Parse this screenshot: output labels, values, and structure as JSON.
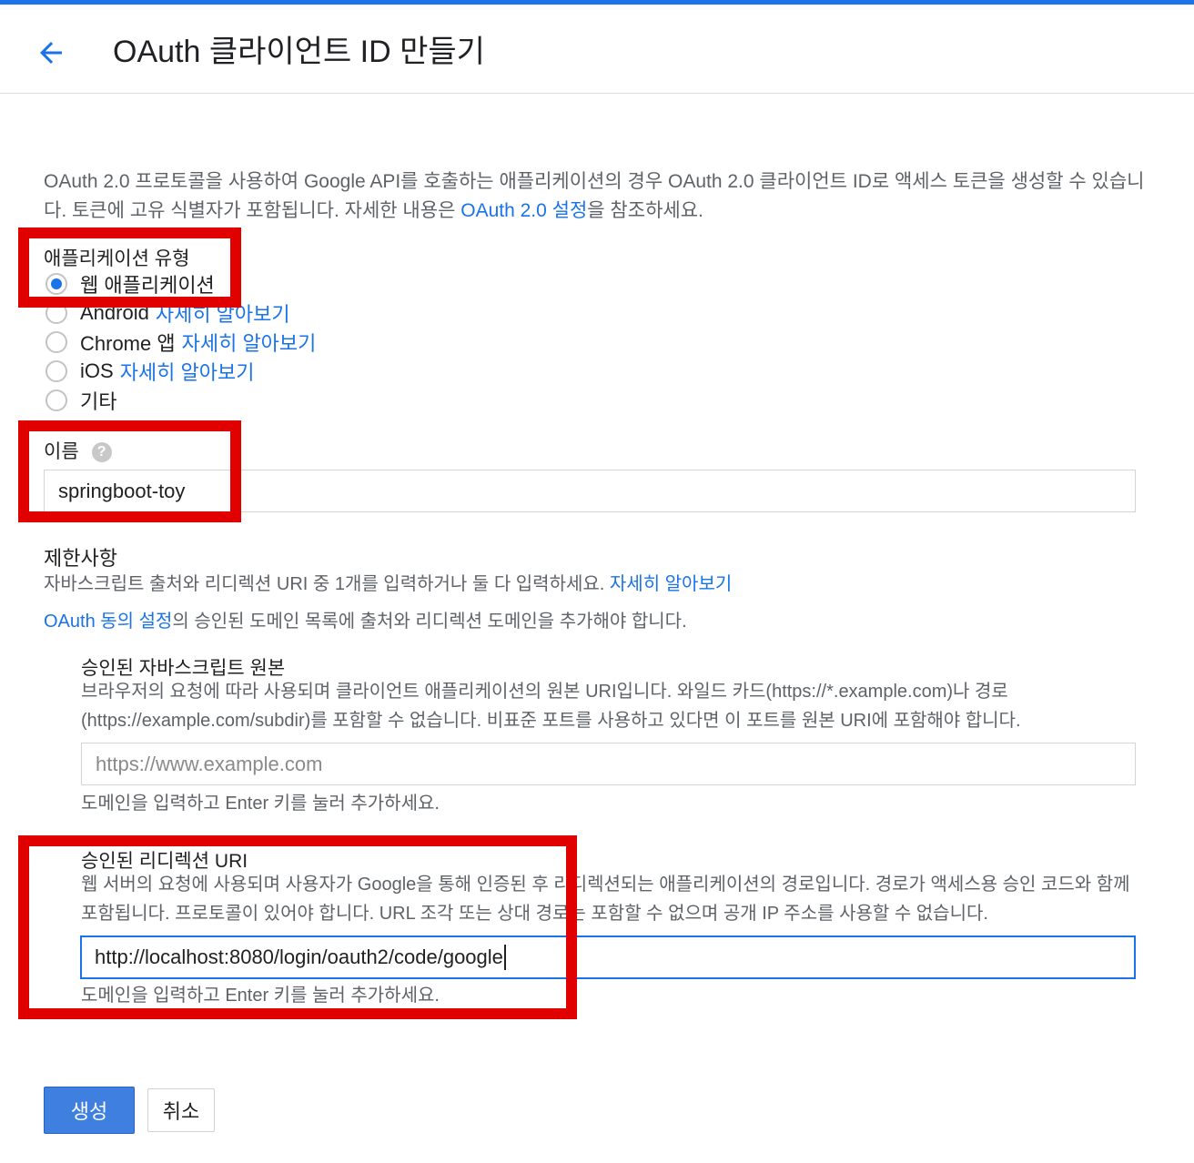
{
  "header": {
    "title": "OAuth 클라이언트 ID 만들기"
  },
  "intro": {
    "text": "OAuth 2.0 프로토콜을 사용하여 Google API를 호출하는 애플리케이션의 경우 OAuth 2.0 클라이언트 ID로 액세스 토큰을 생성할 수 있습니다. 토큰에 고유 식별자가 포함됩니다. 자세한 내용은 ",
    "link": "OAuth 2.0 설정",
    "suffix": "을 참조하세요."
  },
  "app_type": {
    "label": "애플리케이션 유형",
    "selected": "웹 애플리케이션",
    "options": [
      {
        "label": "웹 애플리케이션",
        "link": ""
      },
      {
        "label": "Android",
        "link": "자세히 알아보기"
      },
      {
        "label": "Chrome 앱",
        "link": "자세히 알아보기"
      },
      {
        "label": "iOS",
        "link": "자세히 알아보기"
      },
      {
        "label": "기타",
        "link": ""
      }
    ]
  },
  "name_field": {
    "label": "이름",
    "help_icon": "question-mark-icon",
    "value": "springboot-toy"
  },
  "restrictions": {
    "title": "제한사항",
    "desc": "자바스크립트 출처와 리디렉션 URI 중 1개를 입력하거나 둘 다 입력하세요. ",
    "desc_link": "자세히 알아보기",
    "consent_link": "OAuth 동의 설정",
    "consent_text": "의 승인된 도메인 목록에 출처와 리디렉션 도메인을 추가해야 합니다."
  },
  "js_origins": {
    "title": "승인된 자바스크립트 원본",
    "desc": "브라우저의 요청에 따라 사용되며 클라이언트 애플리케이션의 원본 URI입니다. 와일드 카드(https://*.example.com)나 경로(https://example.com/subdir)를 포함할 수 없습니다. 비표준 포트를 사용하고 있다면 이 포트를 원본 URI에 포함해야 합니다.",
    "placeholder": "https://www.example.com",
    "hint": "도메인을 입력하고 Enter 키를 눌러 추가하세요."
  },
  "redirect_uris": {
    "title": "승인된 리디렉션 URI",
    "desc": "웹 서버의 요청에 사용되며 사용자가 Google을 통해 인증된 후 리디렉션되는 애플리케이션의 경로입니다. 경로가 액세스용 승인 코드와 함께 포함됩니다. 프로토콜이 있어야 합니다. URL 조각 또는 상대 경로는 포함할 수 없으며 공개 IP 주소를 사용할 수 없습니다.",
    "value": "http://localhost:8080/login/oauth2/code/google",
    "hint": "도메인을 입력하고 Enter 키를 눌러 추가하세요."
  },
  "actions": {
    "create": "생성",
    "cancel": "취소"
  },
  "colors": {
    "accent": "#1a73e8",
    "highlight": "#e00000",
    "primary_button": "#3f7fe0"
  }
}
